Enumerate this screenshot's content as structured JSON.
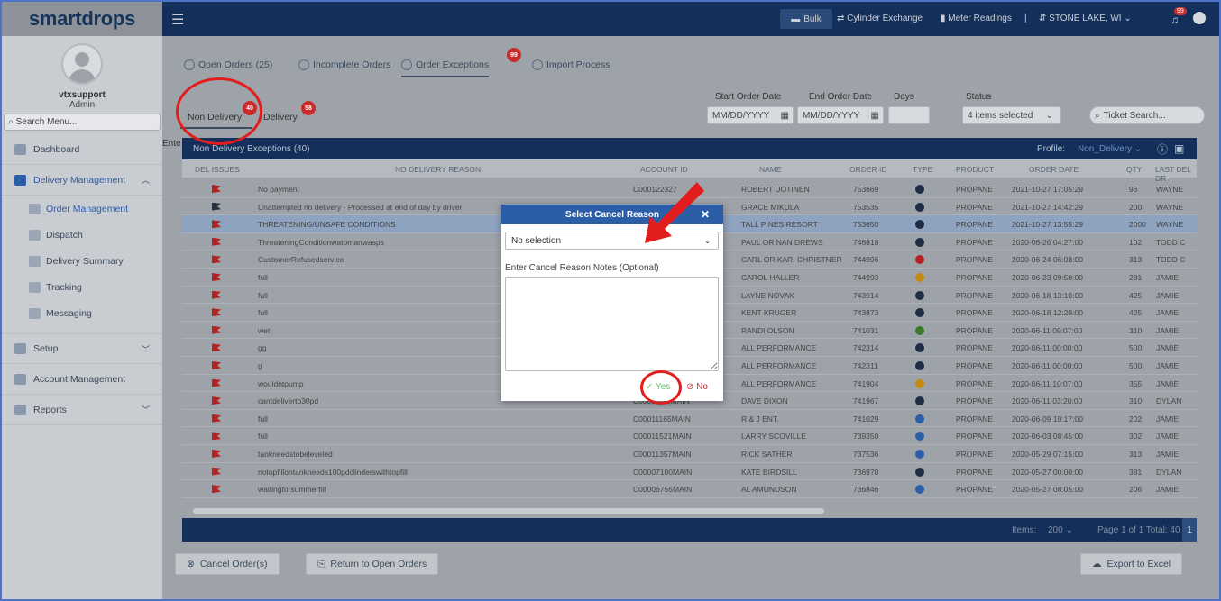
{
  "brand": {
    "name": "smartdrops"
  },
  "user": {
    "name": "vtxsupport",
    "role": "Admin"
  },
  "sidebar": {
    "search_placeholder": "Search Menu...",
    "items": [
      {
        "label": "Dashboard"
      },
      {
        "label": "Delivery Management"
      },
      {
        "label": "Order Management"
      },
      {
        "label": "Dispatch"
      },
      {
        "label": "Delivery Summary"
      },
      {
        "label": "Tracking"
      },
      {
        "label": "Messaging"
      },
      {
        "label": "Setup"
      },
      {
        "label": "Account Management"
      },
      {
        "label": "Reports"
      }
    ]
  },
  "topbar": {
    "bulk": "Bulk",
    "cylinder": "Cylinder Exchange",
    "meter": "Meter Readings",
    "location": "STONE LAKE, WI",
    "notif_count": "99"
  },
  "tabs": [
    {
      "label": "Open Orders (25)"
    },
    {
      "label": "Incomplete Orders"
    },
    {
      "label": "Order Exceptions",
      "badge": "99"
    },
    {
      "label": "Import Process"
    }
  ],
  "subtabs": [
    {
      "label": "Non Delivery",
      "badge": "40"
    },
    {
      "label": "Delivery",
      "badge": "58"
    }
  ],
  "filters": {
    "start_label": "Start Order Date",
    "end_label": "End Order Date",
    "days_label": "Days",
    "status_label": "Status",
    "date_placeholder": "MM/DD/YYYY",
    "status_value": "4 items selected",
    "ticket_placeholder": "Ticket Search..."
  },
  "enter_fragment": "Ente",
  "grid": {
    "title": "Non Delivery Exceptions (40)",
    "profile_label": "Profile:",
    "profile_value": "Non_Delivery",
    "columns": [
      "Del Issues",
      "No Delivery Reason",
      "Account ID",
      "Name",
      "Order ID",
      "Type",
      "Product",
      "Order Date",
      "Qty",
      "Last Del Dr"
    ],
    "rows": [
      {
        "reason": "No payment",
        "account": "C000122327",
        "name": "ROBERT UOTINEN",
        "order": "753669",
        "product": "PROPANE",
        "date": "2021-10-27 17:05:29",
        "qty": "96",
        "last": "WAYNE"
      },
      {
        "reason": "Unattempted no delivery - Processed at end of day by driver",
        "account": "",
        "name": "GRACE MIKULA",
        "order": "753535",
        "product": "PROPANE",
        "date": "2021-10-27 14:42:29",
        "qty": "200",
        "last": "WAYNE"
      },
      {
        "reason": "THREATENING/UNSAFE CONDITIONS",
        "account": "",
        "name": "TALL PINES RESORT",
        "order": "753650",
        "product": "PROPANE",
        "date": "2021-10-27 13:55:29",
        "qty": "2000",
        "last": "WAYNE"
      },
      {
        "reason": "ThreateningConditionwatomanwasps",
        "account": "",
        "name": "PAUL OR NAN DREWS",
        "order": "746818",
        "product": "PROPANE",
        "date": "2020-06-26 04:27:00",
        "qty": "102",
        "last": "TODD C"
      },
      {
        "reason": "CustomerRefusedservice",
        "account": "",
        "name": "CARL OR KARI CHRISTNER",
        "order": "744996",
        "product": "PROPANE",
        "date": "2020-06-24 06:08:00",
        "qty": "313",
        "last": "TODD C"
      },
      {
        "reason": "full",
        "account": "",
        "name": "CAROL HALLER",
        "order": "744993",
        "product": "PROPANE",
        "date": "2020-06-23 09:58:00",
        "qty": "281",
        "last": "JAMIE"
      },
      {
        "reason": "full",
        "account": "",
        "name": "LAYNE NOVAK",
        "order": "743914",
        "product": "PROPANE",
        "date": "2020-06-18 13:10:00",
        "qty": "425",
        "last": "JAMIE"
      },
      {
        "reason": "full",
        "account": "",
        "name": "KENT KRUGER",
        "order": "743873",
        "product": "PROPANE",
        "date": "2020-06-18 12:29:00",
        "qty": "425",
        "last": "JAMIE"
      },
      {
        "reason": "wet",
        "account": "",
        "name": "RANDI OLSON",
        "order": "741031",
        "product": "PROPANE",
        "date": "2020-06-11 09:07:00",
        "qty": "310",
        "last": "JAMIE"
      },
      {
        "reason": "gg",
        "account": "",
        "name": "ALL PERFORMANCE",
        "order": "742314",
        "product": "PROPANE",
        "date": "2020-06-11 00:00:00",
        "qty": "500",
        "last": "JAMIE"
      },
      {
        "reason": "g",
        "account": "",
        "name": "ALL PERFORMANCE",
        "order": "742311",
        "product": "PROPANE",
        "date": "2020-06-11 00:00:00",
        "qty": "500",
        "last": "JAMIE"
      },
      {
        "reason": "wouldntpump",
        "account": "",
        "name": "ALL PERFORMANCE",
        "order": "741904",
        "product": "PROPANE",
        "date": "2020-06-11 10:07:00",
        "qty": "355",
        "last": "JAMIE"
      },
      {
        "reason": "cantdeliverto30pd",
        "account": "C0001...30MAIN",
        "name": "DAVE DIXON",
        "order": "741967",
        "product": "PROPANE",
        "date": "2020-06-11 03:20:00",
        "qty": "310",
        "last": "DYLAN"
      },
      {
        "reason": "full",
        "account": "C00011165MAIN",
        "name": "R & J ENT.",
        "order": "741029",
        "product": "PROPANE",
        "date": "2020-06-09 10:17:00",
        "qty": "202",
        "last": "JAMIE"
      },
      {
        "reason": "full",
        "account": "C00011521MAIN",
        "name": "LARRY SCOVILLE",
        "order": "739350",
        "product": "PROPANE",
        "date": "2020-06-03 08:45:00",
        "qty": "302",
        "last": "JAMIE"
      },
      {
        "reason": "tankneedstobeleveled",
        "account": "C00011357MAIN",
        "name": "RICK SATHER",
        "order": "737536",
        "product": "PROPANE",
        "date": "2020-05-29 07:15:00",
        "qty": "313",
        "last": "JAMIE"
      },
      {
        "reason": "notopfillontankneeds100pdclinderswithtopfill",
        "account": "C00007100MAIN",
        "name": "KATE BIRDSILL",
        "order": "736970",
        "product": "PROPANE",
        "date": "2020-05-27 00:00:00",
        "qty": "381",
        "last": "DYLAN"
      },
      {
        "reason": "waitingforsummerfill",
        "account": "C00006755MAIN",
        "name": "AL AMUNDSON",
        "order": "736846",
        "product": "PROPANE",
        "date": "2020-05-27 08:05:00",
        "qty": "206",
        "last": "JAMIE"
      }
    ],
    "footer": {
      "items_label": "Items:",
      "items_value": "200",
      "page_text": "Page 1 of 1 Total: 40",
      "page_btn": "1"
    }
  },
  "actions": {
    "cancel": "Cancel Order(s)",
    "return": "Return to Open Orders",
    "export": "Export to Excel"
  },
  "modal": {
    "title": "Select Cancel Reason",
    "close": "✕",
    "select_value": "No selection",
    "notes_label": "Enter Cancel Reason Notes (Optional)",
    "yes": "Yes",
    "no": "No"
  }
}
